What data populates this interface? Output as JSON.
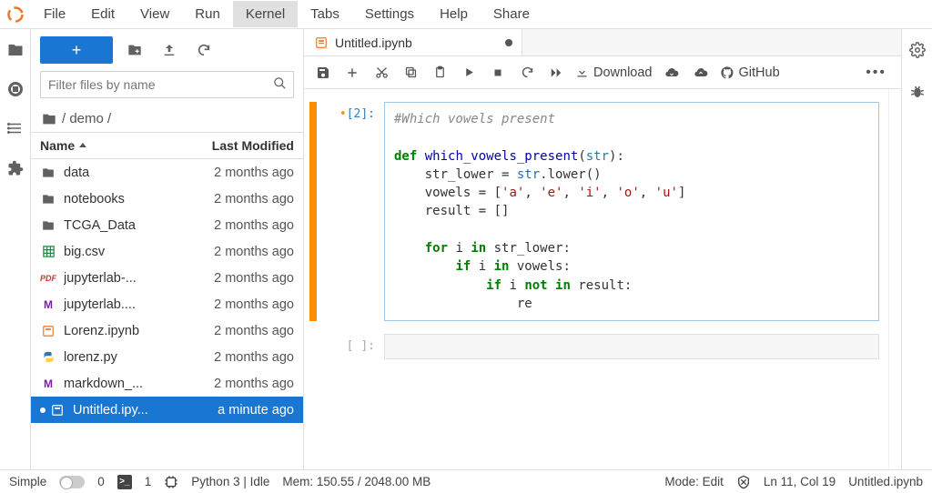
{
  "menu": {
    "items": [
      "File",
      "Edit",
      "View",
      "Run",
      "Kernel",
      "Tabs",
      "Settings",
      "Help",
      "Share"
    ],
    "active": "Kernel"
  },
  "filebrowser": {
    "filter_placeholder": "Filter files by name",
    "crumb": "/ demo /",
    "columns": {
      "name": "Name",
      "modified": "Last Modified"
    },
    "items": [
      {
        "icon": "folder",
        "name": "data",
        "modified": "2 months ago"
      },
      {
        "icon": "folder",
        "name": "notebooks",
        "modified": "2 months ago"
      },
      {
        "icon": "folder",
        "name": "TCGA_Data",
        "modified": "2 months ago"
      },
      {
        "icon": "csv",
        "name": "big.csv",
        "modified": "2 months ago"
      },
      {
        "icon": "pdf",
        "name": "jupyterlab-...",
        "modified": "2 months ago"
      },
      {
        "icon": "md",
        "name": "jupyterlab....",
        "modified": "2 months ago"
      },
      {
        "icon": "nb",
        "name": "Lorenz.ipynb",
        "modified": "2 months ago"
      },
      {
        "icon": "py",
        "name": "lorenz.py",
        "modified": "2 months ago"
      },
      {
        "icon": "md",
        "name": "markdown_...",
        "modified": "2 months ago"
      },
      {
        "icon": "nb",
        "name": "Untitled.ipy...",
        "modified": "a minute ago",
        "selected": true,
        "dirty": true
      }
    ]
  },
  "notebook": {
    "tab_title": "Untitled.ipynb",
    "toolbar": {
      "download": "Download",
      "github": "GitHub"
    },
    "cells": [
      {
        "prompt": "[2]:",
        "dirty": true,
        "code_html": "<span class='cm'>#Which vowels present</span>\n\n<span class='kw'>def</span> <span class='fn'>which_vowels_present</span>(<span class='pa'>str</span>):\n    str_lower = <span class='bi'>str</span>.lower()\n    vowels = [<span class='st'>'a'</span>, <span class='st'>'e'</span>, <span class='st'>'i'</span>, <span class='st'>'o'</span>, <span class='st'>'u'</span>]\n    result = []\n\n    <span class='kw'>for</span> i <span class='kw'>in</span> str_lower:\n        <span class='kw'>if</span> i <span class='kw'>in</span> vowels:\n            <span class='kw'>if</span> i <span class='kw'>not in</span> result:\n                re"
      },
      {
        "prompt": "[ ]:",
        "dirty": false,
        "code_html": ""
      }
    ]
  },
  "status": {
    "simple": "Simple",
    "count0": "0",
    "count1": "1",
    "kernel": "Python 3 | Idle",
    "mem": "Mem: 150.55 / 2048.00 MB",
    "mode": "Mode: Edit",
    "pos": "Ln 11, Col 19",
    "file": "Untitled.ipynb"
  }
}
